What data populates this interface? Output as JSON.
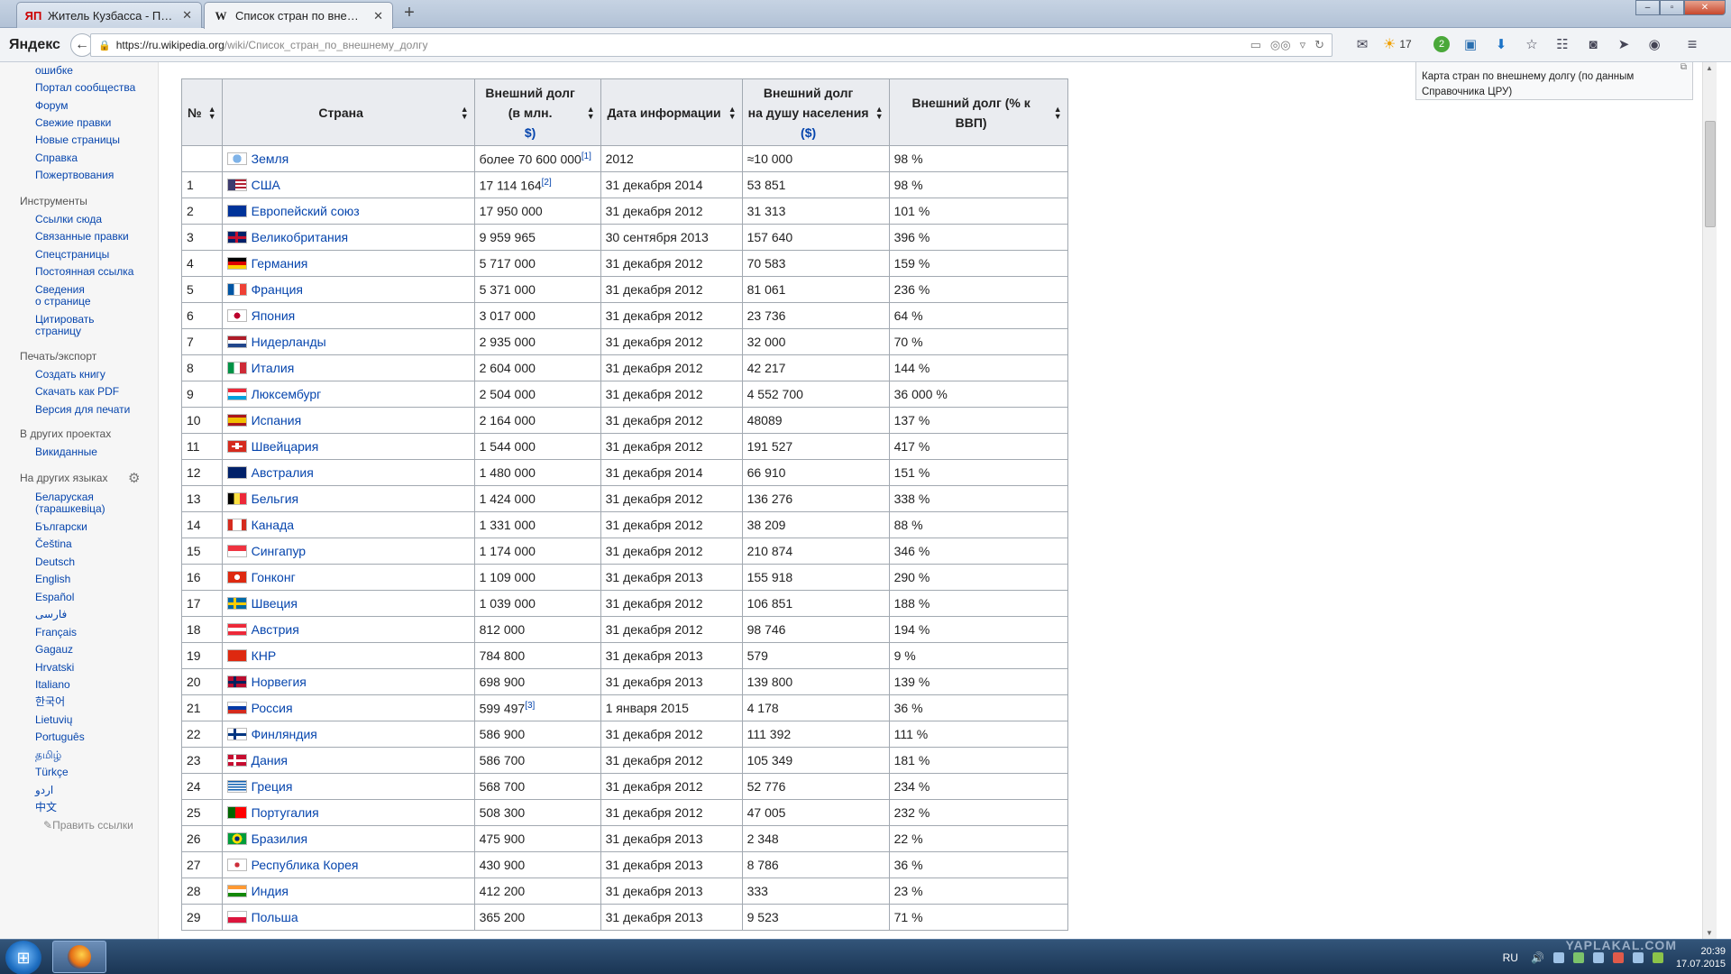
{
  "tabs": [
    {
      "icon_text": "ЯП",
      "title": "Житель Кузбасса - Путин...",
      "close": "✕"
    },
    {
      "icon_text": "W",
      "title": "Список стран по внешне...",
      "close": "✕"
    }
  ],
  "new_tab": "+",
  "window_controls": {
    "minimize": "–",
    "maximize": "▫",
    "close": "✕"
  },
  "browser": {
    "logo": "Яндекс",
    "url_host": "https://ru.wikipedia.org",
    "url_path": "/wiki/Список_стран_по_внешнему_долгу",
    "weather_temp": "17",
    "badge_count": "2"
  },
  "sidebar": {
    "top_links": [
      "ошибке",
      "Портал сообщества",
      "Форум",
      "Свежие правки",
      "Новые страницы",
      "Справка",
      "Пожертвования"
    ],
    "tools_heading": "Инструменты",
    "tools_links": [
      "Ссылки сюда",
      "Связанные правки",
      "Спецстраницы",
      "Постоянная ссылка",
      "Сведения",
      "о странице",
      "Цитировать",
      "страницу"
    ],
    "print_heading": "Печать/экспорт",
    "print_links": [
      "Создать книгу",
      "Скачать как PDF",
      "Версия для печати"
    ],
    "projects_heading": "В других проектах",
    "projects_links": [
      "Викиданные"
    ],
    "languages_heading": "На других языках",
    "languages": [
      "Беларуская",
      "(тарашкевіца)",
      "Български",
      "Čeština",
      "Deutsch",
      "English",
      "Español",
      "فارسی",
      "Français",
      "Gagauz",
      "Hrvatski",
      "Italiano",
      "한국어",
      "Lietuvių",
      "Português",
      "தமிழ்",
      "Türkçe",
      "اردو",
      "中文"
    ],
    "edit_links": "Править ссылки"
  },
  "map_caption": "Карта стран по внешнему долгу (по данным Справочника ЦРУ)",
  "table": {
    "headers": {
      "num": "№",
      "country": "Страна",
      "debt_l1": "Внешний долг",
      "debt_l2": "(в млн.",
      "debt_l3": "$)",
      "date": "Дата информации",
      "percap_l1": "Внешний долг",
      "percap_l2": "на душу населения",
      "percap_l3": "($)",
      "gdp": "Внешний долг (% к ВВП)"
    },
    "rows": [
      {
        "num": "",
        "flag": "earth",
        "country": "Земля",
        "debt": "более 70 600 000",
        "ref": "[1]",
        "date": "2012",
        "percap": "≈10 000",
        "gdp": "98 %"
      },
      {
        "num": "1",
        "flag": "us",
        "country": "США",
        "debt": "17 114 164",
        "ref": "[2]",
        "date": "31 декабря 2014",
        "percap": "53 851",
        "gdp": "98 %"
      },
      {
        "num": "2",
        "flag": "eu",
        "country": "Европейский союз",
        "debt": "17 950 000",
        "ref": "",
        "date": "31 декабря 2012",
        "percap": "31 313",
        "gdp": "101 %"
      },
      {
        "num": "3",
        "flag": "uk",
        "country": "Великобритания",
        "debt": "9 959 965",
        "ref": "",
        "date": "30 сентября 2013",
        "percap": "157 640",
        "gdp": "396 %"
      },
      {
        "num": "4",
        "flag": "de",
        "country": "Германия",
        "debt": "5 717 000",
        "ref": "",
        "date": "31 декабря 2012",
        "percap": "70 583",
        "gdp": "159 %"
      },
      {
        "num": "5",
        "flag": "fr",
        "country": "Франция",
        "debt": "5 371 000",
        "ref": "",
        "date": "31 декабря 2012",
        "percap": "81 061",
        "gdp": "236 %"
      },
      {
        "num": "6",
        "flag": "jp",
        "country": "Япония",
        "debt": "3 017 000",
        "ref": "",
        "date": "31 декабря 2012",
        "percap": "23 736",
        "gdp": "64 %"
      },
      {
        "num": "7",
        "flag": "nl",
        "country": "Нидерланды",
        "debt": "2 935 000",
        "ref": "",
        "date": "31 декабря 2012",
        "percap": "32 000",
        "gdp": "70 %"
      },
      {
        "num": "8",
        "flag": "it",
        "country": "Италия",
        "debt": "2 604 000",
        "ref": "",
        "date": "31 декабря 2012",
        "percap": "42 217",
        "gdp": "144 %"
      },
      {
        "num": "9",
        "flag": "lu",
        "country": "Люксембург",
        "debt": "2 504 000",
        "ref": "",
        "date": "31 декабря 2012",
        "percap": "4 552 700",
        "gdp": "36 000 %"
      },
      {
        "num": "10",
        "flag": "es",
        "country": "Испания",
        "debt": "2 164 000",
        "ref": "",
        "date": "31 декабря 2012",
        "percap": "48089",
        "gdp": "137 %"
      },
      {
        "num": "11",
        "flag": "ch",
        "country": "Швейцария",
        "debt": "1 544 000",
        "ref": "",
        "date": "31 декабря 2012",
        "percap": "191 527",
        "gdp": "417 %"
      },
      {
        "num": "12",
        "flag": "au",
        "country": "Австралия",
        "debt": "1 480 000",
        "ref": "",
        "date": "31 декабря 2014",
        "percap": "66 910",
        "gdp": "151 %"
      },
      {
        "num": "13",
        "flag": "be",
        "country": "Бельгия",
        "debt": "1 424 000",
        "ref": "",
        "date": "31 декабря 2012",
        "percap": "136 276",
        "gdp": "338 %"
      },
      {
        "num": "14",
        "flag": "ca",
        "country": "Канада",
        "debt": "1 331 000",
        "ref": "",
        "date": "31 декабря 2012",
        "percap": "38 209",
        "gdp": "88 %"
      },
      {
        "num": "15",
        "flag": "sg",
        "country": "Сингапур",
        "debt": "1 174 000",
        "ref": "",
        "date": "31 декабря 2012",
        "percap": "210 874",
        "gdp": "346 %"
      },
      {
        "num": "16",
        "flag": "hk",
        "country": "Гонконг",
        "debt": "1 109 000",
        "ref": "",
        "date": "31 декабря 2013",
        "percap": "155 918",
        "gdp": "290 %"
      },
      {
        "num": "17",
        "flag": "se",
        "country": "Швеция",
        "debt": "1 039 000",
        "ref": "",
        "date": "31 декабря 2012",
        "percap": "106 851",
        "gdp": "188 %"
      },
      {
        "num": "18",
        "flag": "at",
        "country": "Австрия",
        "debt": "812 000",
        "ref": "",
        "date": "31 декабря 2012",
        "percap": "98 746",
        "gdp": "194 %"
      },
      {
        "num": "19",
        "flag": "cn",
        "country": "КНР",
        "debt": "784 800",
        "ref": "",
        "date": "31 декабря 2013",
        "percap": "579",
        "gdp": "9 %"
      },
      {
        "num": "20",
        "flag": "no",
        "country": "Норвегия",
        "debt": "698 900",
        "ref": "",
        "date": "31 декабря 2013",
        "percap": "139 800",
        "gdp": "139 %"
      },
      {
        "num": "21",
        "flag": "ru",
        "country": "Россия",
        "debt": "599 497",
        "ref": "[3]",
        "date": "1 января 2015",
        "percap": "4 178",
        "gdp": "36 %"
      },
      {
        "num": "22",
        "flag": "fi",
        "country": "Финляндия",
        "debt": "586 900",
        "ref": "",
        "date": "31 декабря 2012",
        "percap": "111 392",
        "gdp": "111 %"
      },
      {
        "num": "23",
        "flag": "dk",
        "country": "Дания",
        "debt": "586 700",
        "ref": "",
        "date": "31 декабря 2012",
        "percap": "105 349",
        "gdp": "181 %"
      },
      {
        "num": "24",
        "flag": "gr",
        "country": "Греция",
        "debt": "568 700",
        "ref": "",
        "date": "31 декабря 2012",
        "percap": "52 776",
        "gdp": "234 %"
      },
      {
        "num": "25",
        "flag": "pt",
        "country": "Португалия",
        "debt": "508 300",
        "ref": "",
        "date": "31 декабря 2012",
        "percap": "47 005",
        "gdp": "232 %"
      },
      {
        "num": "26",
        "flag": "br",
        "country": "Бразилия",
        "debt": "475 900",
        "ref": "",
        "date": "31 декабря 2013",
        "percap": "2 348",
        "gdp": "22 %"
      },
      {
        "num": "27",
        "flag": "kr",
        "country": "Республика Корея",
        "debt": "430 900",
        "ref": "",
        "date": "31 декабря 2013",
        "percap": "8 786",
        "gdp": "36 %"
      },
      {
        "num": "28",
        "flag": "in",
        "country": "Индия",
        "debt": "412 200",
        "ref": "",
        "date": "31 декабря 2013",
        "percap": "333",
        "gdp": "23 %"
      },
      {
        "num": "29",
        "flag": "pl",
        "country": "Польша",
        "debt": "365 200",
        "ref": "",
        "date": "31 декабря 2013",
        "percap": "9 523",
        "gdp": "71 %"
      }
    ]
  },
  "taskbar": {
    "lang": "RU",
    "time": "20:39",
    "date": "17.07.2015",
    "watermark": "YAPLAKAL.COM"
  }
}
